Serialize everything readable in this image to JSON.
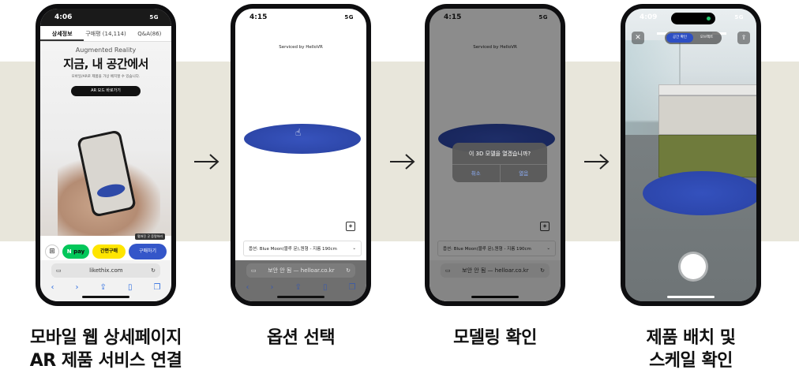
{
  "phones": {
    "p1": {
      "time": "4:06",
      "signal": "5G",
      "tabs": [
        "상세정보",
        "구매평 (14,114)",
        "Q&A(86)"
      ],
      "hero_label": "Augmented Reality",
      "hero_title": "지금, 내 공간에서",
      "hero_sub": "모바일/AR로 제품을 가상 배치할 수 있습니다.",
      "ar_button": "AR 모드 바로가기",
      "label_tag": "펼쳐진 곳 증명하러",
      "npay": "pay",
      "kakao": "간편구매",
      "buy": "구매하기",
      "url": "likethix.com"
    },
    "p2": {
      "time": "4:15",
      "signal": "5G",
      "serviced": "Serviced by HelloVR",
      "option": "옵션: Blue Moon(블루 문),원형 - 지름 190cm",
      "url": "보안 안 됨 — helloar.co.kr"
    },
    "p3": {
      "time": "4:15",
      "signal": "5G",
      "serviced": "Serviced by HelloVR",
      "option": "옵션: Blue Moon(블루 문),원형 - 지름 190cm",
      "url": "보안 안 됨 — helloar.co.kr",
      "dialog_msg": "이 3D 모델을 열겠습니까?",
      "cancel": "취소",
      "open": "열음"
    },
    "p4": {
      "time": "4:09",
      "signal": "5G",
      "seg": [
        "공간 확인",
        "오브젝트"
      ]
    }
  },
  "captions": [
    [
      "모바일 웹 상세페이지",
      "AR 제품 서비스 연결"
    ],
    [
      "옵션 선택"
    ],
    [
      "모델링 확인"
    ],
    [
      "제품 배치 및",
      "스케일 확인"
    ]
  ],
  "colors": {
    "band": "#e8e6db",
    "rug": "#2f49b0",
    "buy": "#3456c9",
    "npay": "#03c75a",
    "kakao": "#fee500"
  }
}
